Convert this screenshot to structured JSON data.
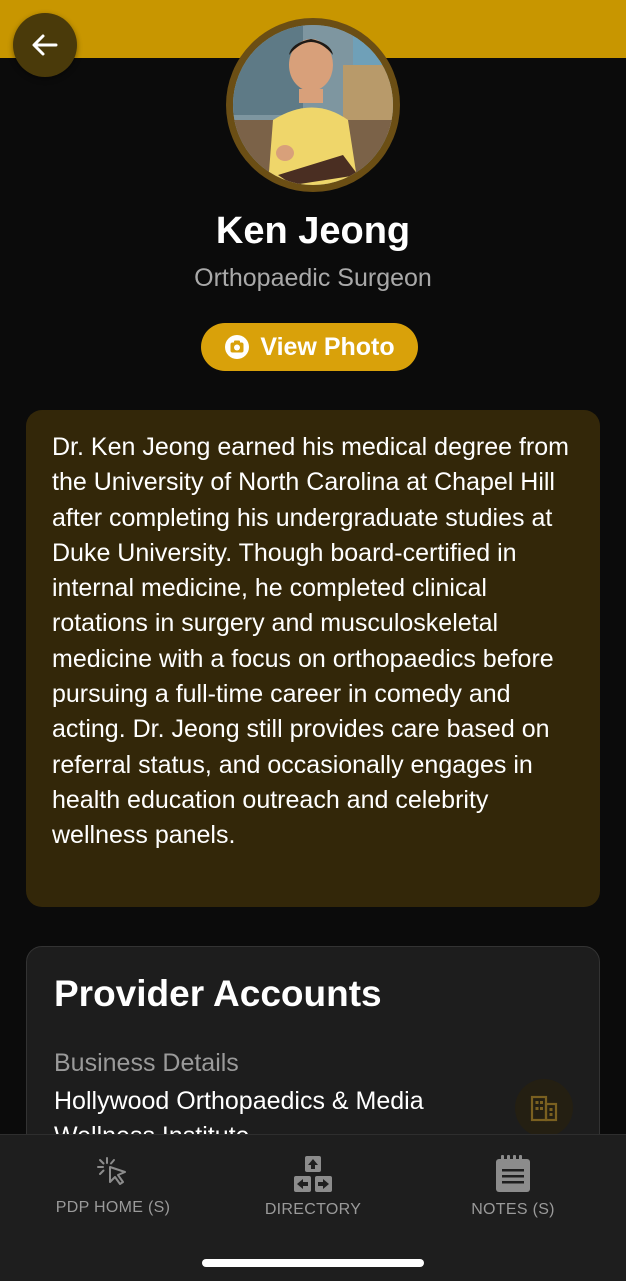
{
  "header": {
    "back_icon": "arrow-left-icon",
    "accent_color": "#c89600"
  },
  "profile": {
    "name": "Ken Jeong",
    "title": "Orthopaedic Surgeon",
    "view_photo_label": "View Photo",
    "view_photo_icon": "camera-icon"
  },
  "bio": {
    "text": "Dr. Ken Jeong earned his medical degree from the University of North Carolina at Chapel Hill after completing his undergraduate studies at Duke University. Though board-certified in internal medicine, he completed clinical rotations in surgery and musculoskeletal medicine with a focus on orthopaedics before pursuing a full-time career in comedy and acting. Dr. Jeong still provides care based on referral status, and occasionally engages in health education outreach and celebrity wellness panels."
  },
  "provider_accounts": {
    "title": "Provider Accounts",
    "business_label": "Business Details",
    "business_name": "Hollywood Orthopaedics & Media Wellness Institute",
    "business_icon": "building-icon"
  },
  "tab_bar": {
    "tabs": [
      {
        "label": "PDP HOME (S)",
        "icon": "cursor-click-icon"
      },
      {
        "label": "DIRECTORY",
        "icon": "directory-arrows-icon"
      },
      {
        "label": "NOTES (S)",
        "icon": "notepad-icon"
      }
    ]
  }
}
